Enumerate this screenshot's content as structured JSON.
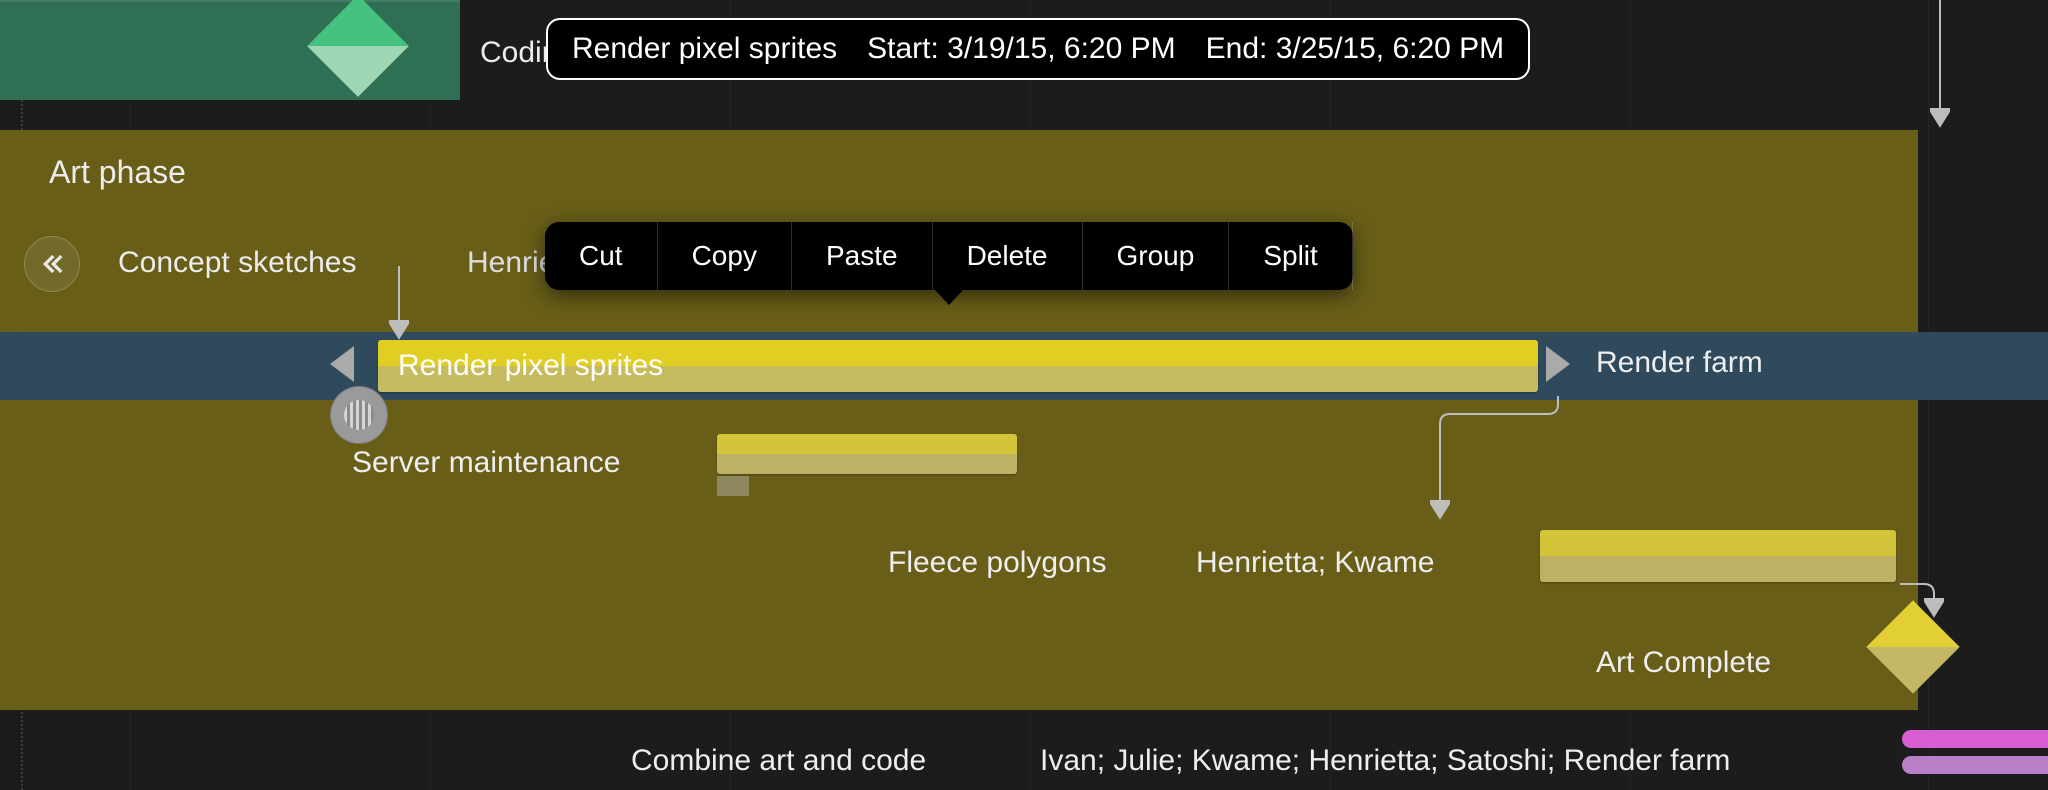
{
  "tooltip": {
    "task_name": "Render pixel sprites",
    "start_label": "Start: 3/19/15, 6:20 PM",
    "end_label": "End: 3/25/15, 6:20 PM"
  },
  "context_menu": {
    "cut": "Cut",
    "copy": "Copy",
    "paste": "Paste",
    "delete": "Delete",
    "group": "Group",
    "split": "Split"
  },
  "milestones": {
    "coding_complete": "Coding Complete",
    "art_complete": "Art Complete"
  },
  "phase": {
    "art": "Art phase"
  },
  "tasks": {
    "concept_sketches": {
      "label": "Concept sketches",
      "resources": "Henrietta; Kwame"
    },
    "render_sprites": {
      "label": "Render pixel sprites",
      "right_label": "Render farm"
    },
    "server_maint": {
      "label": "Server maintenance"
    },
    "fleece_polygons": {
      "label": "Fleece polygons",
      "resources": "Henrietta; Kwame"
    },
    "combine": {
      "label": "Combine art and code",
      "resources": "Ivan; Julie; Kwame; Henrietta; Satoshi; Render farm"
    }
  }
}
